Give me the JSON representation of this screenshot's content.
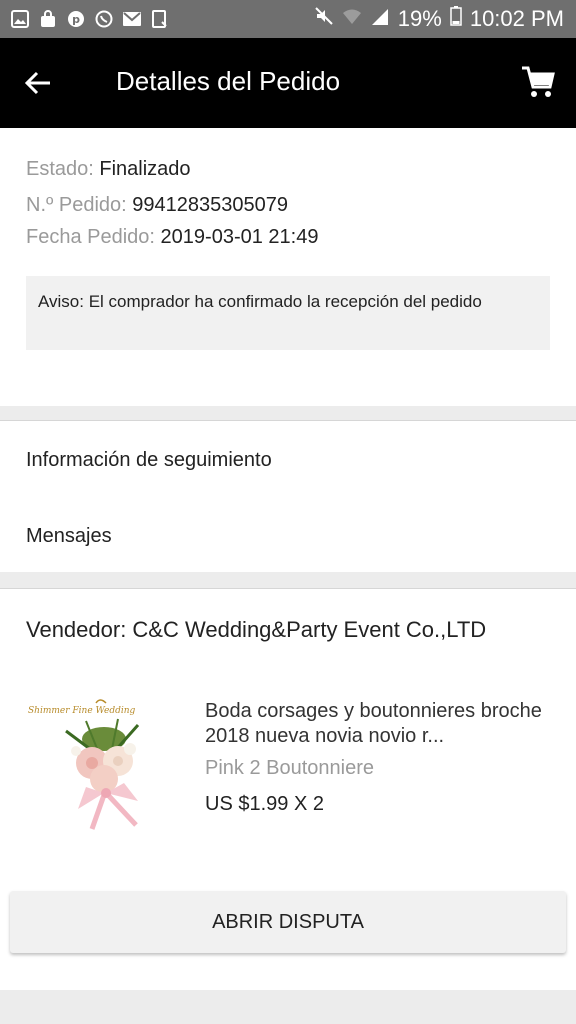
{
  "status_bar": {
    "battery": "19%",
    "time": "10:02 PM"
  },
  "appbar": {
    "title": "Detalles del Pedido"
  },
  "order": {
    "estado_label": "Estado:",
    "estado_value": "Finalizado",
    "pedido_label": "N.º Pedido:",
    "pedido_value": "99412835305079",
    "fecha_label": "Fecha Pedido:",
    "fecha_value": "2019-03-01 21:49",
    "notice": "Aviso: El comprador ha confirmado la recepción del pedido"
  },
  "links": {
    "tracking": "Información de seguimiento",
    "messages": "Mensajes"
  },
  "vendor": {
    "label": "Vendedor: C&C Wedding&Party Event Co.,LTD"
  },
  "product": {
    "name": "Boda corsages y boutonnieres broche 2018 nueva novia novio r...",
    "variant": "Pink 2 Boutonniere",
    "price": "US $1.99 X 2"
  },
  "actions": {
    "dispute": "ABRIR DISPUTA"
  },
  "colors": {
    "statusbar": "#6f6f6f",
    "appbar": "#000000",
    "label_gray": "#9a9a9a"
  }
}
